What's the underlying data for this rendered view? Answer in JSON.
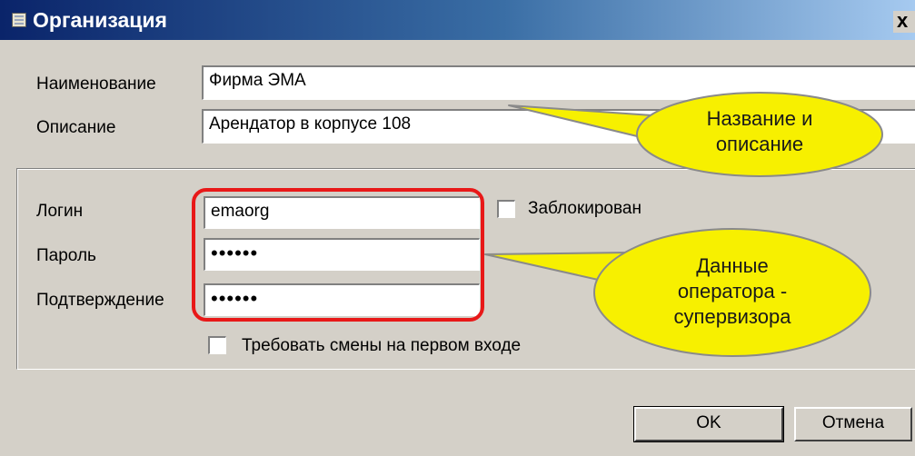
{
  "window": {
    "title": "Организация",
    "close_glyph": "x"
  },
  "form": {
    "name_label": "Наименование",
    "name_value": "Фирма ЭМА",
    "description_label": "Описание",
    "description_value": "Арендатор в корпусе 108",
    "login_label": "Логин",
    "login_value": "emaorg",
    "password_label": "Пароль",
    "password_value": "••••••",
    "confirm_label": "Подтверждение",
    "confirm_value": "••••••",
    "blocked_label": "Заблокирован",
    "blocked_checked": false,
    "require_change_label": "Требовать смены на первом входе",
    "require_change_checked": false
  },
  "buttons": {
    "ok": "OK",
    "cancel": "Отмена"
  },
  "callouts": {
    "name_desc_line1": "Название и",
    "name_desc_line2": "описание",
    "operator_line1": "Данные",
    "operator_line2": "оператора -",
    "operator_line3": "супервизора"
  },
  "colors": {
    "callout_fill": "#f7f000",
    "highlight_frame": "#e81818",
    "titlebar": "#0a246a"
  },
  "icons": {
    "app": "table-icon",
    "close": "close-icon"
  }
}
